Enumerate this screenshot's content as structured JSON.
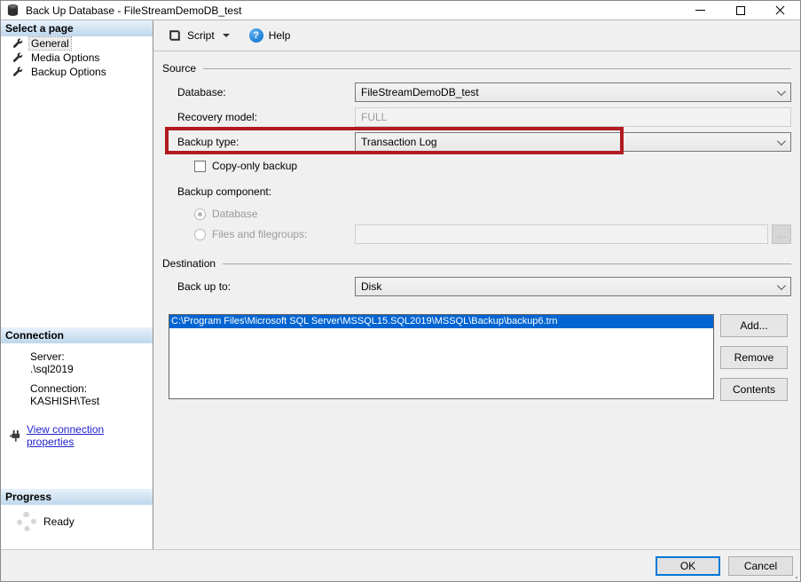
{
  "colors": {
    "annotation": "#b11a20",
    "selection": "#0064d2",
    "link": "#2222cc",
    "help_icon": "#1f7fd4",
    "ok_focus": "#0078d7"
  },
  "window": {
    "title": "Back Up Database - FileStreamDemoDB_test"
  },
  "toolbar": {
    "script_label": "Script",
    "help_label": "Help",
    "help_icon_glyph": "?"
  },
  "sidebar": {
    "select_a_page": "Select a page",
    "pages": [
      {
        "label": "General"
      },
      {
        "label": "Media Options"
      },
      {
        "label": "Backup Options"
      }
    ],
    "connection_header": "Connection",
    "server_label": "Server:",
    "server_value": ".\\sql2019",
    "connection_label": "Connection:",
    "connection_value": "KASHISH\\Test",
    "view_connection_properties": "View connection properties",
    "progress_header": "Progress",
    "progress_status": "Ready"
  },
  "source": {
    "section_label": "Source",
    "database_label": "Database:",
    "database_value": "FileStreamDemoDB_test",
    "recovery_model_label": "Recovery model:",
    "recovery_model_value": "FULL",
    "backup_type_label": "Backup type:",
    "backup_type_value": "Transaction Log",
    "copy_only_label": "Copy-only backup",
    "backup_component_label": "Backup component:",
    "radio_database_label": "Database",
    "radio_files_label": "Files and filegroups:",
    "files_value": "",
    "browse_button": "..."
  },
  "destination": {
    "section_label": "Destination",
    "back_up_to_label": "Back up to:",
    "back_up_to_value": "Disk",
    "paths": [
      "C:\\Program Files\\Microsoft SQL Server\\MSSQL15.SQL2019\\MSSQL\\Backup\\backup6.trn"
    ],
    "add_button": "Add...",
    "remove_button": "Remove",
    "contents_button": "Contents"
  },
  "footer": {
    "ok_button": "OK",
    "cancel_button": "Cancel"
  }
}
